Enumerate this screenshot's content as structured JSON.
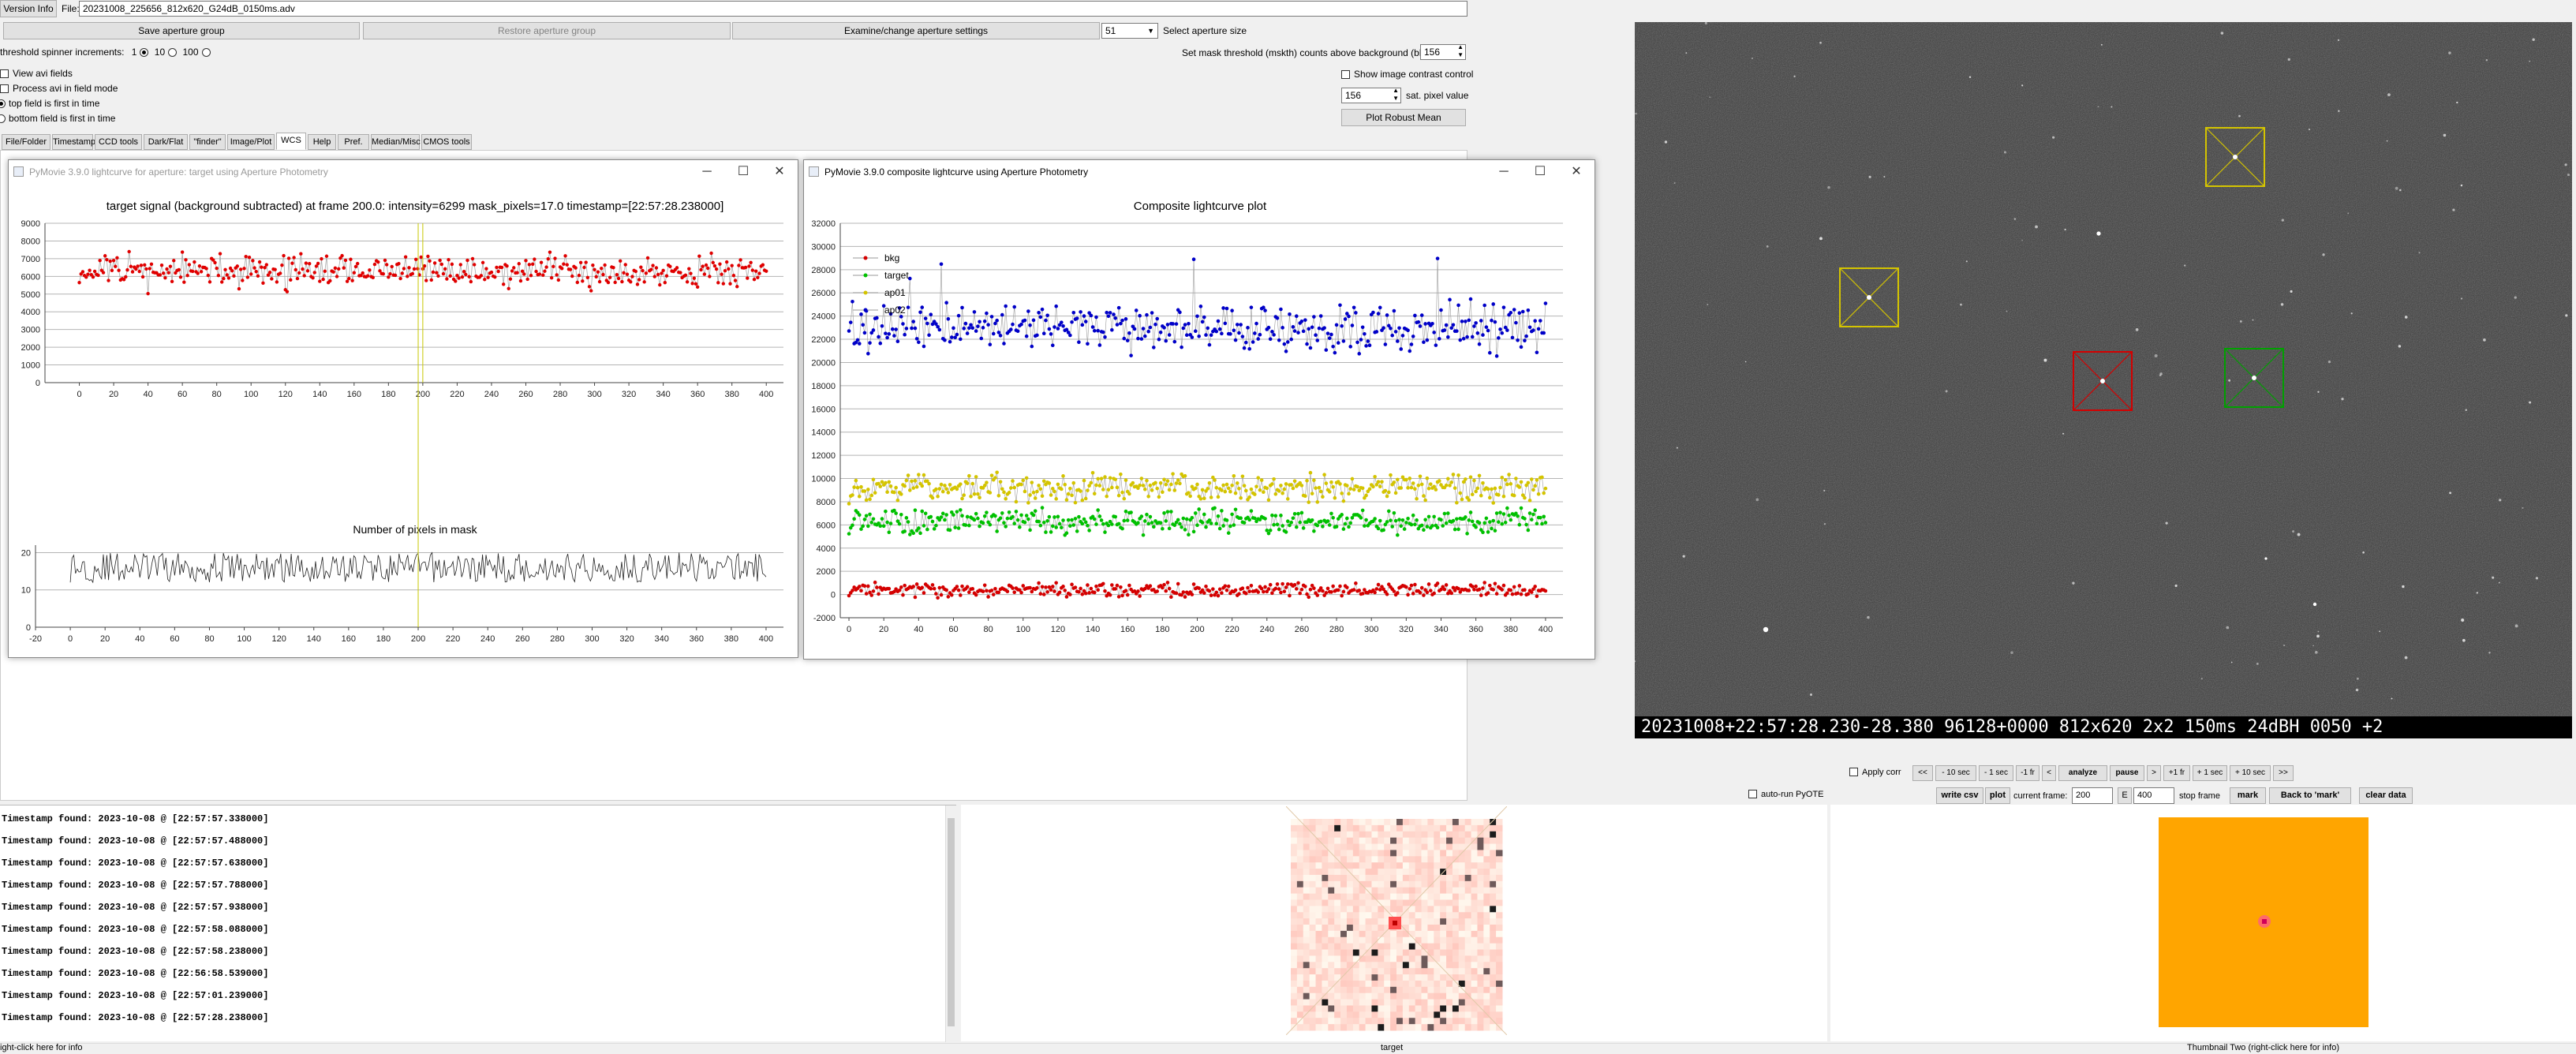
{
  "top": {
    "version_info": "Version Info",
    "file_label": "File:",
    "file_value": "20231008_225656_812x620_G24dB_0150ms.adv"
  },
  "aperture": {
    "save": "Save aperture group",
    "restore": "Restore aperture group",
    "examine": "Examine/change aperture settings",
    "size_value": "51",
    "size_label": "Select aperture size"
  },
  "threshold": {
    "spinner_label": "threshold spinner increments:",
    "opt1": "1",
    "opt10": "10",
    "opt100": "100",
    "mask_label": "Set mask threshold (mskth) counts above background (bkavg)",
    "mask_value": "156"
  },
  "options": {
    "view_avi": "View avi fields",
    "process_avi": "Process avi in field mode",
    "top_field": "top field is first in time",
    "bottom_field": "bottom field is first in time",
    "show_contrast": "Show image contrast control",
    "sat_value": "156",
    "sat_label": "sat. pixel value",
    "robust_mean": "Plot Robust Mean"
  },
  "tabs": [
    "File/Folder",
    "Timestamp",
    "CCD tools",
    "Dark/Flat",
    "\"finder\"",
    "Image/Plot",
    "WCS",
    "Help",
    "Pref.",
    "Median/Misc",
    "CMOS tools"
  ],
  "win1": {
    "title": "PyMovie 3.9.0 lightcurve for aperture: target using Aperture Photometry",
    "plot_title": "target signal (background subtracted) at frame 200.0: intensity=6299 mask_pixels=17.0 timestamp=[22:57:28.238000]",
    "sub_title": "Number of pixels in mask"
  },
  "win2": {
    "title": "PyMovie 3.9.0 composite lightcurve using Aperture Photometry",
    "plot_title": "Composite lightcurve plot",
    "legend": [
      "bkg",
      "target",
      "ap01",
      "ap02"
    ]
  },
  "image": {
    "overlay": "20231008+22:57:28.230-28.380 96128+0000   812x620 2x2  150ms 24dBH 0050 +2"
  },
  "controls": {
    "apply_corr": "Apply corr",
    "nav": [
      "<<",
      "- 10 sec",
      "- 1 sec",
      "-1 fr",
      "<",
      "analyze",
      "pause",
      ">",
      "+1 fr",
      "+ 1 sec",
      "+ 10 sec",
      ">>"
    ],
    "auto_run": "auto-run PyOTE",
    "write_csv": "write csv",
    "plot": "plot",
    "current_frame_label": "current frame:",
    "current_frame": "200",
    "e_label": "E",
    "stop_value": "400",
    "stop_label": "stop frame",
    "mark": "mark",
    "back_to_mark": "Back to 'mark'",
    "clear_data": "clear data"
  },
  "log": [
    "Timestamp found: 2023-10-08 @ [22:57:57.338000]",
    "Timestamp found: 2023-10-08 @ [22:57:57.488000]",
    "Timestamp found: 2023-10-08 @ [22:57:57.638000]",
    "Timestamp found: 2023-10-08 @ [22:57:57.788000]",
    "Timestamp found: 2023-10-08 @ [22:57:57.938000]",
    "Timestamp found: 2023-10-08 @ [22:57:58.088000]",
    "Timestamp found: 2023-10-08 @ [22:57:58.238000]",
    "Timestamp found: 2023-10-08 @ [22:56:58.539000]",
    "Timestamp found: 2023-10-08 @ [22:57:01.239000]",
    "Timestamp found: 2023-10-08 @ [22:57:28.238000]"
  ],
  "status": {
    "left": "ight-click here for info",
    "center": "target",
    "right": "Thumbnail Two (right-click here for info)"
  },
  "colors": {
    "bkg": "#d40000",
    "target": "#00c000",
    "ap01": "#d4c400",
    "ap02": "#0000c8",
    "thumb_two": "#ffa500"
  },
  "chart_data": [
    {
      "type": "scatter",
      "title": "target signal (background subtracted) at frame 200.0: intensity=6299 mask_pixels=17.0 timestamp=[22:57:28.238000]",
      "x_range": [
        -20,
        410
      ],
      "ylim": [
        0,
        9000
      ],
      "yticks": [
        0,
        1000,
        2000,
        3000,
        4000,
        5000,
        6000,
        7000,
        8000,
        9000
      ],
      "xticks": [
        0,
        20,
        40,
        60,
        80,
        100,
        120,
        140,
        160,
        180,
        200,
        220,
        240,
        260,
        280,
        300,
        320,
        340,
        360,
        380,
        400
      ],
      "series": [
        {
          "mean": 6300,
          "spread": 800,
          "color": "#e00000"
        }
      ],
      "cursor_frame": 200,
      "grid": true
    },
    {
      "type": "line",
      "title": "Number of pixels in mask",
      "x_range": [
        -20,
        410
      ],
      "ylim": [
        0,
        22
      ],
      "yticks": [
        0,
        10,
        20
      ],
      "xticks": [
        -20,
        0,
        20,
        40,
        60,
        80,
        100,
        120,
        140,
        160,
        180,
        200,
        220,
        240,
        260,
        280,
        300,
        320,
        340,
        360,
        380,
        400
      ],
      "series": [
        {
          "mean": 16,
          "spread": 4
        }
      ],
      "cursor_frame": 200
    },
    {
      "type": "scatter",
      "title": "Composite lightcurve plot",
      "x_range": [
        -5,
        410
      ],
      "ylim": [
        -2000,
        32000
      ],
      "yticks": [
        -2000,
        0,
        2000,
        4000,
        6000,
        8000,
        10000,
        12000,
        14000,
        16000,
        18000,
        20000,
        22000,
        24000,
        26000,
        28000,
        30000,
        32000
      ],
      "xticks": [
        0,
        20,
        40,
        60,
        80,
        100,
        120,
        140,
        160,
        180,
        200,
        220,
        240,
        260,
        280,
        300,
        320,
        340,
        360,
        380,
        400
      ],
      "series": [
        {
          "name": "bkg",
          "mean": 400,
          "spread": 500,
          "color": "#d40000"
        },
        {
          "name": "target",
          "mean": 6300,
          "spread": 900,
          "color": "#00c000"
        },
        {
          "name": "ap01",
          "mean": 9200,
          "spread": 1000,
          "color": "#d4c400"
        },
        {
          "name": "ap02",
          "mean": 23000,
          "spread": 1800,
          "color": "#0000c8"
        }
      ],
      "legend": "top-left",
      "grid": true
    }
  ]
}
